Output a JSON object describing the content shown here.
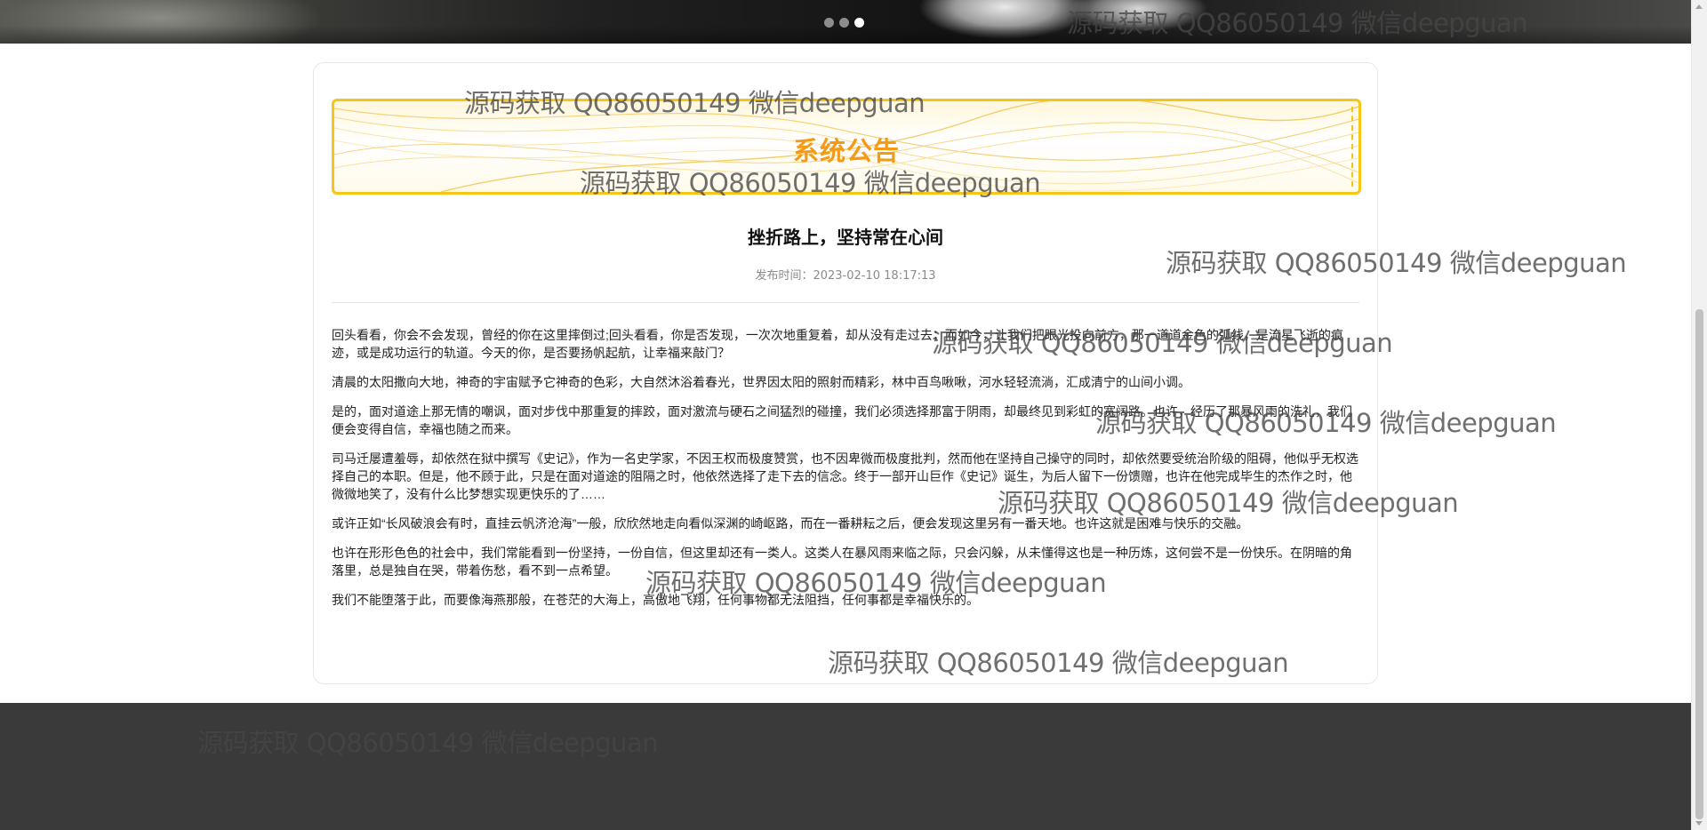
{
  "carousel": {
    "total_slides": 3,
    "active_index": 2
  },
  "notice": {
    "banner_title": "系统公告",
    "article_title": "挫折路上，坚持常在心间",
    "publish_label": "发布时间：",
    "publish_time": "2023-02-10 18:17:13",
    "paragraphs": [
      "回头看看，你会不会发现，曾经的你在这里摔倒过;回头看看，你是否发现，一次次地重复着，却从没有走过去；而如今，让我们把眼光投向前方，那一道道金色的弧线，是流星飞逝的痕迹，或是成功运行的轨道。今天的你，是否要扬帆起航，让幸福来敲门？",
      "清晨的太阳撒向大地，神奇的宇宙赋予它神奇的色彩，大自然沐浴着春光，世界因太阳的照射而精彩，林中百鸟啾啾，河水轻轻流淌，汇成清宁的山间小调。",
      "是的，面对道途上那无情的嘲讽，面对步伐中那重复的摔跤，面对激流与硬石之间猛烈的碰撞，我们必须选择那富于阴雨，却最终见到彩虹的宽阔路。也许，经历了那暴风雨的洗礼，我们便会变得自信，幸福也随之而来。",
      "司马迁屡遭羞辱，却依然在狱中撰写《史记》，作为一名史学家，不因王权而极度赞赏，也不因卑微而极度批判，然而他在坚持自己操守的同时，却依然要受统治阶级的阻碍，他似乎无权选择自己的本职。但是，他不顾于此，只是在面对道途的阻隔之时，他依然选择了走下去的信念。终于一部开山巨作《史记》诞生，为后人留下一份馈赠，也许在他完成毕生的杰作之时，他微微地笑了，没有什么比梦想实现更快乐的了……",
      "或许正如“长风破浪会有时，直挂云帆济沧海”一般，欣欣然地走向看似深渊的崎岖路，而在一番耕耘之后，便会发现这里另有一番天地。也许这就是困难与快乐的交融。",
      "也许在形形色色的社会中，我们常能看到一份坚持，一份自信，但这里却还有一类人。这类人在暴风雨来临之际，只会闪躲，从未懂得这也是一种历炼，这何尝不是一份快乐。在阴暗的角落里，总是独自在哭，带着伤愁，看不到一点希望。",
      "我们不能堕落于此，而要像海燕那般，在苍茫的大海上，高傲地飞翔，任何事物都无法阻挡，任何事都是幸福快乐的。"
    ]
  },
  "watermark": {
    "text": "源码获取 QQ86050149 微信deepguan"
  },
  "colors": {
    "accent": "#f59a17",
    "banner_border": "#f5c518",
    "footer_bg": "#3a3a3a",
    "meta_text": "#8a8a8a"
  }
}
